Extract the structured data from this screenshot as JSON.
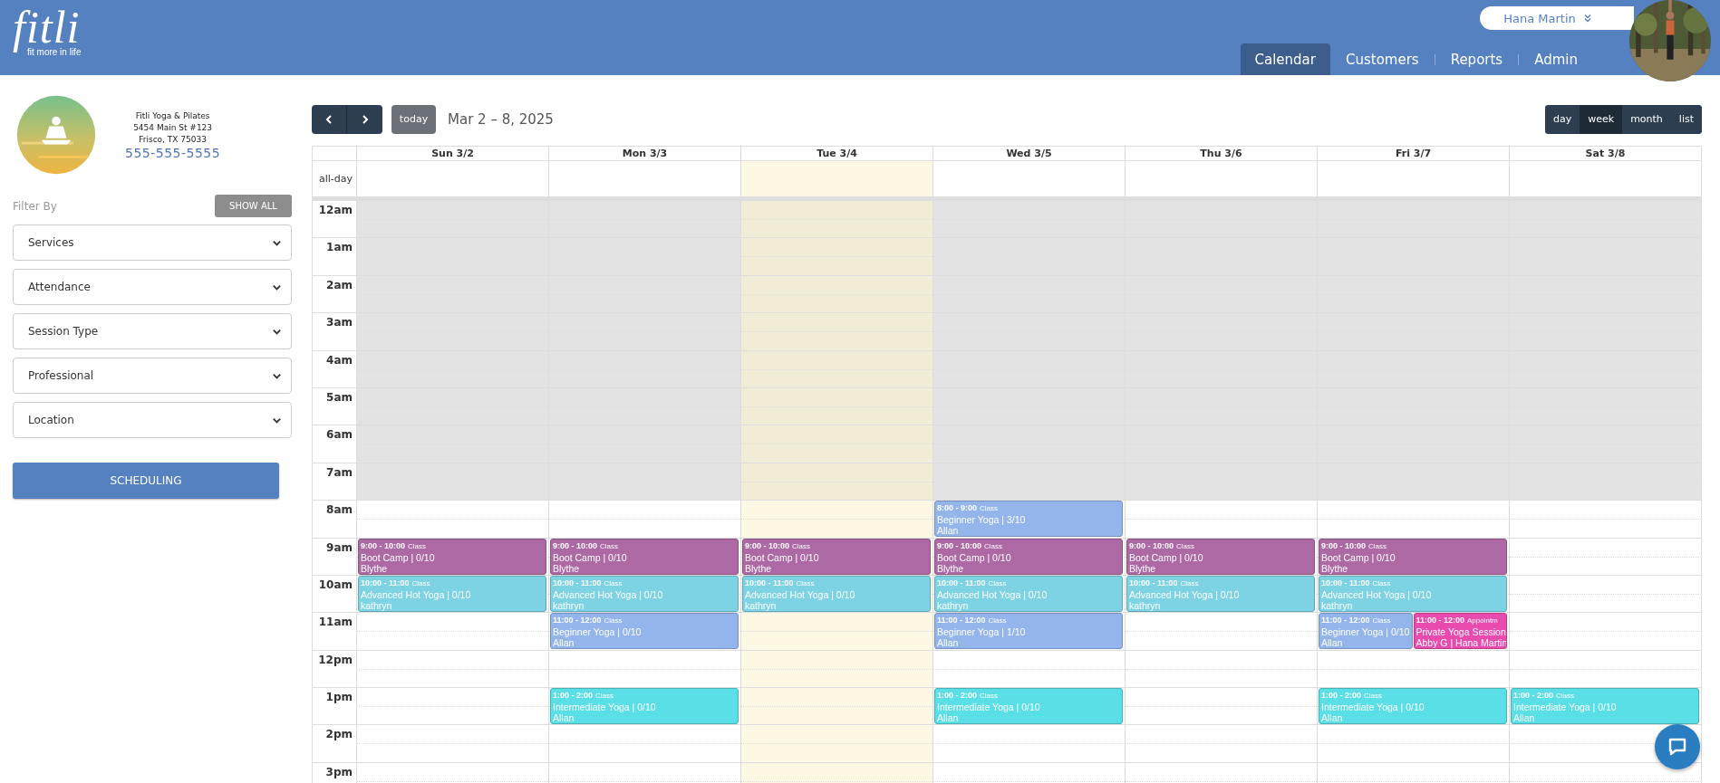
{
  "brand": {
    "name": "fitli",
    "tagline": "fit more in life"
  },
  "user": {
    "name": "Hana Martin"
  },
  "nav": [
    {
      "label": "Calendar",
      "selected": true
    },
    {
      "label": "Customers",
      "selected": false
    },
    {
      "label": "Reports",
      "selected": false
    },
    {
      "label": "Admin",
      "selected": false
    }
  ],
  "studio": {
    "name": "Fitli Yoga & Pilates",
    "address": "5454 Main St #123",
    "city": "Frisco, TX 75033",
    "phone": "555-555-5555"
  },
  "filter": {
    "label": "Filter By",
    "show_all": "SHOW ALL",
    "selects": [
      "Services",
      "Attendance",
      "Session Type",
      "Professional",
      "Location"
    ],
    "scheduling": "SCHEDULING"
  },
  "toolbar": {
    "today": "today",
    "title": "Mar 2 – 8, 2025",
    "views": [
      {
        "label": "day",
        "selected": false
      },
      {
        "label": "week",
        "selected": true
      },
      {
        "label": "month",
        "selected": false
      },
      {
        "label": "list",
        "selected": false
      }
    ]
  },
  "calendar": {
    "all_day": "all-day",
    "days": [
      {
        "label": "Sun 3/2",
        "today": false
      },
      {
        "label": "Mon 3/3",
        "today": false
      },
      {
        "label": "Tue 3/4",
        "today": true
      },
      {
        "label": "Wed 3/5",
        "today": false
      },
      {
        "label": "Thu 3/6",
        "today": false
      },
      {
        "label": "Fri 3/7",
        "today": false
      },
      {
        "label": "Sat 3/8",
        "today": false
      }
    ],
    "hours": [
      {
        "label": "12am",
        "business": false,
        "cells": [
          [],
          [],
          [],
          [],
          [],
          [],
          []
        ]
      },
      {
        "label": "1am",
        "business": false,
        "cells": [
          [],
          [],
          [],
          [],
          [],
          [],
          []
        ]
      },
      {
        "label": "2am",
        "business": false,
        "cells": [
          [],
          [],
          [],
          [],
          [],
          [],
          []
        ]
      },
      {
        "label": "3am",
        "business": false,
        "cells": [
          [],
          [],
          [],
          [],
          [],
          [],
          []
        ]
      },
      {
        "label": "4am",
        "business": false,
        "cells": [
          [],
          [],
          [],
          [],
          [],
          [],
          []
        ]
      },
      {
        "label": "5am",
        "business": false,
        "cells": [
          [],
          [],
          [],
          [],
          [],
          [],
          []
        ]
      },
      {
        "label": "6am",
        "business": false,
        "cells": [
          [],
          [],
          [],
          [],
          [],
          [],
          []
        ]
      },
      {
        "label": "7am",
        "business": false,
        "cells": [
          [],
          [],
          [],
          [],
          [],
          [],
          []
        ]
      },
      {
        "label": "8am",
        "business": true,
        "cells": [
          [],
          [],
          [],
          [
            {
              "time": "8:00 - 9:00",
              "type": "Class",
              "title": "Beginner Yoga | 3/10",
              "people": "Allan",
              "color": "#93b5ec"
            }
          ],
          [],
          [],
          []
        ]
      },
      {
        "label": "9am",
        "business": true,
        "cells": [
          [
            {
              "time": "9:00 - 10:00",
              "type": "Class",
              "title": "Boot Camp | 0/10",
              "people": "Blythe",
              "color": "#ac69a3"
            }
          ],
          [
            {
              "time": "9:00 - 10:00",
              "type": "Class",
              "title": "Boot Camp | 0/10",
              "people": "Blythe",
              "color": "#ac69a3"
            }
          ],
          [
            {
              "time": "9:00 - 10:00",
              "type": "Class",
              "title": "Boot Camp | 0/10",
              "people": "Blythe",
              "color": "#ac69a3"
            }
          ],
          [
            {
              "time": "9:00 - 10:00",
              "type": "Class",
              "title": "Boot Camp | 0/10",
              "people": "Blythe",
              "color": "#ac69a3"
            }
          ],
          [
            {
              "time": "9:00 - 10:00",
              "type": "Class",
              "title": "Boot Camp | 0/10",
              "people": "Blythe",
              "color": "#ac69a3"
            }
          ],
          [
            {
              "time": "9:00 - 10:00",
              "type": "Class",
              "title": "Boot Camp | 0/10",
              "people": "Blythe",
              "color": "#ac69a3"
            }
          ],
          []
        ]
      },
      {
        "label": "10am",
        "business": true,
        "cells": [
          [
            {
              "time": "10:00 - 11:00",
              "type": "Class",
              "title": "Advanced Hot Yoga | 0/10",
              "people": "kathryn",
              "color": "#7dd3e3"
            }
          ],
          [
            {
              "time": "10:00 - 11:00",
              "type": "Class",
              "title": "Advanced Hot Yoga | 0/10",
              "people": "kathryn",
              "color": "#7dd3e3"
            }
          ],
          [
            {
              "time": "10:00 - 11:00",
              "type": "Class",
              "title": "Advanced Hot Yoga | 0/10",
              "people": "kathryn",
              "color": "#7dd3e3"
            }
          ],
          [
            {
              "time": "10:00 - 11:00",
              "type": "Class",
              "title": "Advanced Hot Yoga | 0/10",
              "people": "kathryn",
              "color": "#7dd3e3"
            }
          ],
          [
            {
              "time": "10:00 - 11:00",
              "type": "Class",
              "title": "Advanced Hot Yoga | 0/10",
              "people": "kathryn",
              "color": "#7dd3e3"
            }
          ],
          [
            {
              "time": "10:00 - 11:00",
              "type": "Class",
              "title": "Advanced Hot Yoga | 0/10",
              "people": "kathryn",
              "color": "#7dd3e3"
            }
          ],
          []
        ]
      },
      {
        "label": "11am",
        "business": true,
        "cells": [
          [],
          [
            {
              "time": "11:00 - 12:00",
              "type": "Class",
              "title": "Beginner Yoga | 0/10",
              "people": "Allan",
              "color": "#93b5ec"
            }
          ],
          [],
          [
            {
              "time": "11:00 - 12:00",
              "type": "Class",
              "title": "Beginner Yoga | 1/10",
              "people": "Allan",
              "color": "#93b5ec"
            }
          ],
          [],
          [
            {
              "time": "11:00 - 12:00",
              "type": "Class",
              "title": "Beginner Yoga | 0/10",
              "people": "Allan",
              "color": "#93b5ec"
            },
            {
              "time": "11:00 - 12:00",
              "type": "Appointm",
              "title": "Private Yoga Session",
              "people": "Abby G | Hana Martin",
              "color": "#e84aad"
            }
          ],
          []
        ]
      },
      {
        "label": "12pm",
        "business": true,
        "cells": [
          [],
          [],
          [],
          [],
          [],
          [],
          []
        ]
      },
      {
        "label": "1pm",
        "business": true,
        "cells": [
          [],
          [
            {
              "time": "1:00 - 2:00",
              "type": "Class",
              "title": "Intermediate Yoga | 0/10",
              "people": "Allan",
              "color": "#5adfe6"
            }
          ],
          [],
          [
            {
              "time": "1:00 - 2:00",
              "type": "Class",
              "title": "Intermediate Yoga | 0/10",
              "people": "Allan",
              "color": "#5adfe6"
            }
          ],
          [],
          [
            {
              "time": "1:00 - 2:00",
              "type": "Class",
              "title": "Intermediate Yoga | 0/10",
              "people": "Allan",
              "color": "#5adfe6"
            }
          ],
          [
            {
              "time": "1:00 - 2:00",
              "type": "Class",
              "title": "Intermediate Yoga | 0/10",
              "people": "Allan",
              "color": "#5adfe6"
            }
          ]
        ]
      },
      {
        "label": "2pm",
        "business": true,
        "cells": [
          [],
          [],
          [],
          [],
          [],
          [],
          []
        ]
      },
      {
        "label": "3pm",
        "business": true,
        "cells": [
          [],
          [],
          [],
          [],
          [],
          [],
          []
        ]
      }
    ]
  }
}
